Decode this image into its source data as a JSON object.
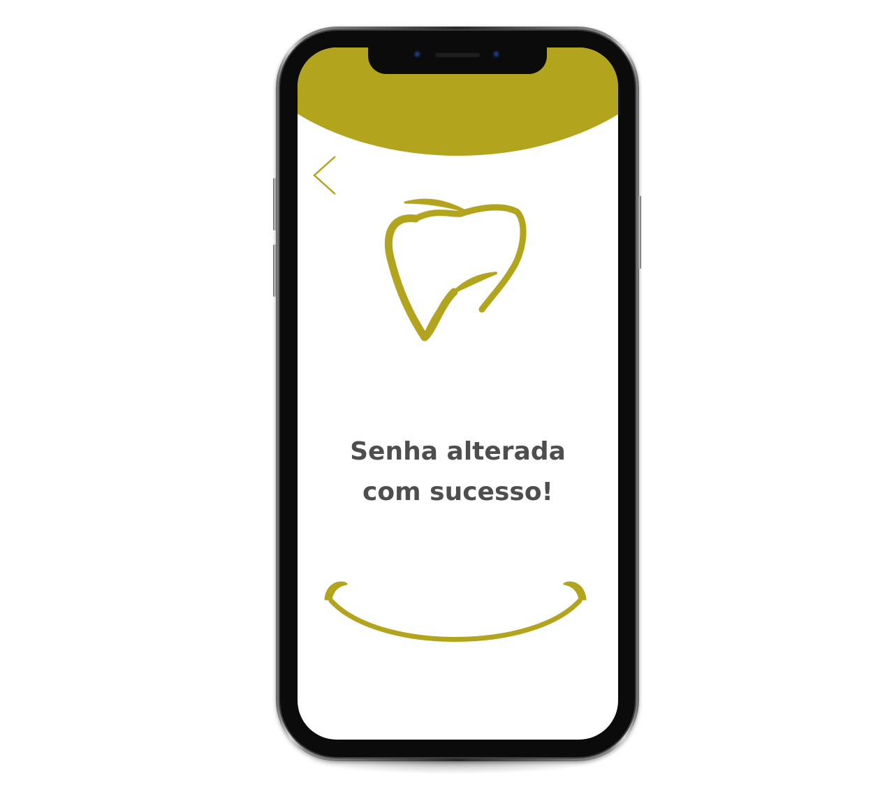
{
  "colors": {
    "accent": "#b2a41c",
    "text": "#4e4e4e",
    "background": "#ffffff"
  },
  "screen": {
    "back_icon": "chevron-left-icon",
    "logo_icon": "tooth-icon",
    "message": {
      "line1": "Senha alterada",
      "line2": "com sucesso!"
    },
    "decoration_icon": "smile-icon"
  }
}
